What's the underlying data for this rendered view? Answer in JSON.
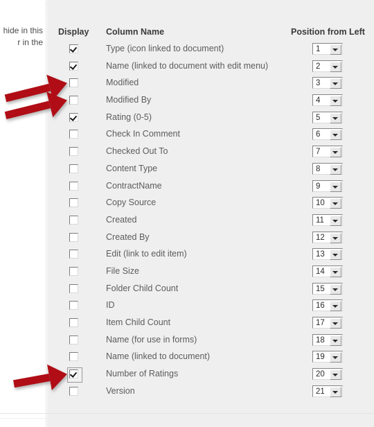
{
  "left_pane": {
    "clipped_text_line1": "hide in this",
    "clipped_text_line2": "r in the"
  },
  "table": {
    "headers": {
      "display": "Display",
      "column_name": "Column Name",
      "position": "Position from Left"
    },
    "rows": [
      {
        "checked": true,
        "focused": false,
        "name": "Type (icon linked to document)",
        "position": "1"
      },
      {
        "checked": true,
        "focused": false,
        "name": "Name (linked to document with edit menu)",
        "position": "2"
      },
      {
        "checked": false,
        "focused": false,
        "name": "Modified",
        "position": "3"
      },
      {
        "checked": false,
        "focused": false,
        "name": "Modified By",
        "position": "4"
      },
      {
        "checked": true,
        "focused": false,
        "name": "Rating (0-5)",
        "position": "5"
      },
      {
        "checked": false,
        "focused": false,
        "name": "Check In Comment",
        "position": "6"
      },
      {
        "checked": false,
        "focused": false,
        "name": "Checked Out To",
        "position": "7"
      },
      {
        "checked": false,
        "focused": false,
        "name": "Content Type",
        "position": "8"
      },
      {
        "checked": false,
        "focused": false,
        "name": "ContractName",
        "position": "9"
      },
      {
        "checked": false,
        "focused": false,
        "name": "Copy Source",
        "position": "10"
      },
      {
        "checked": false,
        "focused": false,
        "name": "Created",
        "position": "11"
      },
      {
        "checked": false,
        "focused": false,
        "name": "Created By",
        "position": "12"
      },
      {
        "checked": false,
        "focused": false,
        "name": "Edit (link to edit item)",
        "position": "13"
      },
      {
        "checked": false,
        "focused": false,
        "name": "File Size",
        "position": "14"
      },
      {
        "checked": false,
        "focused": false,
        "name": "Folder Child Count",
        "position": "15"
      },
      {
        "checked": false,
        "focused": false,
        "name": "ID",
        "position": "16"
      },
      {
        "checked": false,
        "focused": false,
        "name": "Item Child Count",
        "position": "17"
      },
      {
        "checked": false,
        "focused": false,
        "name": "Name (for use in forms)",
        "position": "18"
      },
      {
        "checked": false,
        "focused": false,
        "name": "Name (linked to document)",
        "position": "19"
      },
      {
        "checked": true,
        "focused": true,
        "name": "Number of Ratings",
        "position": "20"
      },
      {
        "checked": false,
        "focused": false,
        "name": "Version",
        "position": "21"
      }
    ]
  },
  "annotations": {
    "arrow_color": "#b01116",
    "arrows": [
      {
        "target_row_index": 2,
        "label": "arrow-pointing-to-modified-checkbox"
      },
      {
        "target_row_index": 3,
        "label": "arrow-pointing-to-modified-by-checkbox"
      },
      {
        "target_row_index": 19,
        "label": "arrow-pointing-to-number-of-ratings-checkbox"
      }
    ]
  },
  "colors": {
    "panel_background": "#efefef",
    "page_background": "#ffffff",
    "header_text": "#3a3a3a",
    "row_text": "#5c5c5c",
    "divider": "#e6e6e6"
  }
}
